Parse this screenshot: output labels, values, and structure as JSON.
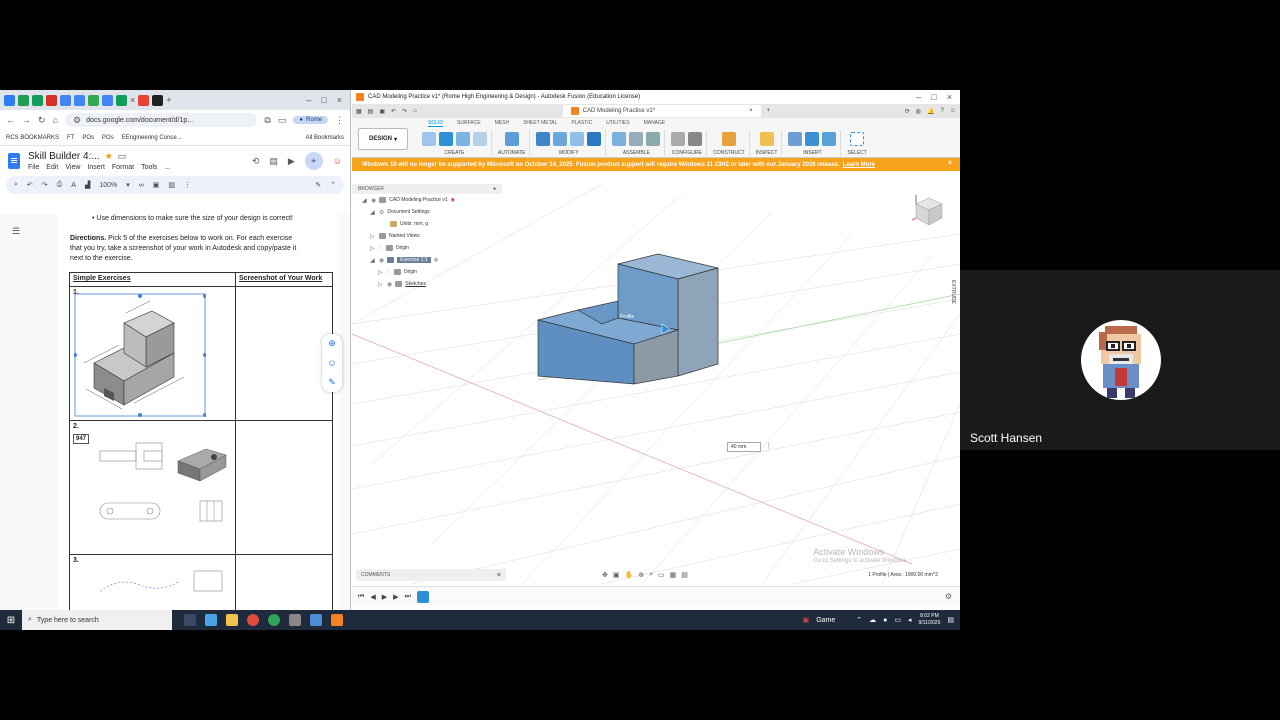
{
  "chrome": {
    "url": "docs.google.com/document/d/1p...",
    "profile_label": "Rome",
    "bookmarks": [
      "RCS BOOKMARKS",
      "FT",
      "POs",
      "POs",
      "EEngineering Conce...",
      "All Bookmarks"
    ],
    "doc_title": "Skill Builder 4:...",
    "menu": [
      "File",
      "Edit",
      "View",
      "Insert",
      "Format",
      "Tools",
      "..."
    ],
    "zoom": "100%"
  },
  "doc": {
    "bullet": "Use dimensions to make sure the size of your design is correct!",
    "directions_label": "Directions.",
    "directions_text": "Pick 5 of the exercises below to work on. For each exercise that you try, take a screenshot of your work in Autodesk and copy/paste it next to the exercise.",
    "table_headers": [
      "Simple Exercises",
      "Screenshot of Your Work"
    ],
    "rows": [
      "1.",
      "2.",
      "3."
    ],
    "badge": "947"
  },
  "fusion": {
    "window_title": "CAD Modeling Practice v1* (Rome High Engineering & Design) - Autodesk Fusion (Education License)",
    "doc_tab": "CAD Modeling Practice v1*",
    "design_button": "DESIGN",
    "ribbon_tabs": [
      "SOLID",
      "SURFACE",
      "MESH",
      "SHEET METAL",
      "PLASTIC",
      "UTILITIES",
      "MANAGE"
    ],
    "ribbon_groups": [
      "CREATE",
      "AUTOMATE",
      "MODIFY",
      "ASSEMBLE",
      "CONFIGURE",
      "CONSTRUCT",
      "INSPECT",
      "INSERT",
      "SELECT"
    ],
    "banner": "Windows 10 will no longer be supported by Microsoft on October 14, 2025. Fusion product support will require Windows 11 23H2 or later with our January 2026 release.",
    "banner_link": "Learn More",
    "browser_title": "BROWSER",
    "browser_items": [
      {
        "label": "CAD Modeling Practice v1",
        "indent": 0
      },
      {
        "label": "Document Settings",
        "indent": 1
      },
      {
        "label": "Units: mm, g",
        "indent": 2
      },
      {
        "label": "Named Views",
        "indent": 1
      },
      {
        "label": "Origin",
        "indent": 1
      },
      {
        "label": "Exercise 1:1",
        "indent": 1
      },
      {
        "label": "Origin",
        "indent": 2
      },
      {
        "label": "Sketches",
        "indent": 2
      }
    ],
    "dimension_value": "40 mm",
    "face_label": "Profile",
    "extrude_label": "EXTRUDE",
    "comments_label": "COMMENTS",
    "status_text": "1 Profile | Area : 1900.00 mm^2",
    "activate_title": "Activate Windows",
    "activate_sub": "Go to Settings to activate Windows."
  },
  "taskbar": {
    "search_placeholder": "Type here to search",
    "game_label": "Game",
    "time": "8:02 PM",
    "date": "9/11/2025"
  },
  "participant": {
    "name": "Scott Hansen"
  }
}
